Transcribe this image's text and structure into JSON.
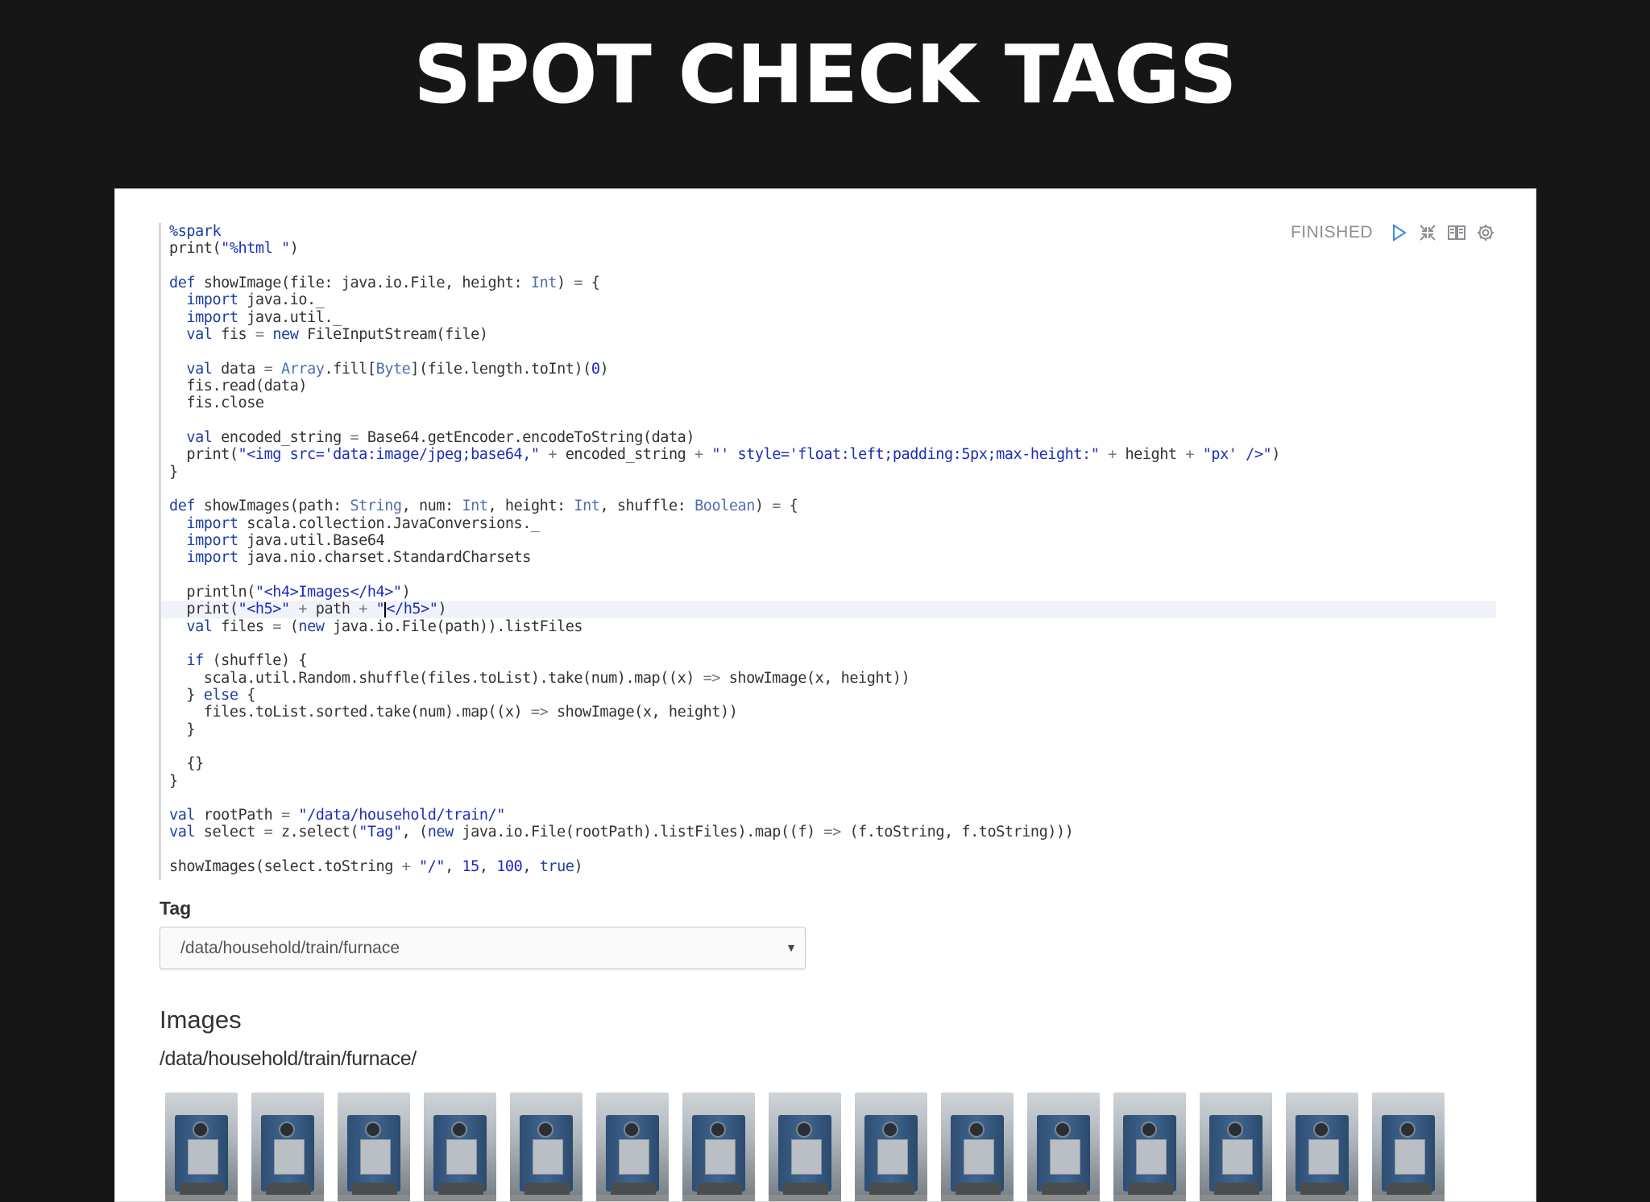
{
  "slide": {
    "title": "SPOT CHECK TAGS"
  },
  "paragraph": {
    "status": "FINISHED",
    "toolbar_icons": [
      "run-icon",
      "collapse-icon",
      "book-icon",
      "gear-icon"
    ],
    "code_lines": [
      [
        [
          "kw",
          "%spark"
        ]
      ],
      [
        [
          "plain",
          "print("
        ],
        [
          "str",
          "\"%html \""
        ],
        [
          "plain",
          ")"
        ]
      ],
      [],
      [
        [
          "kw",
          "def"
        ],
        [
          "plain",
          " showImage(file: java.io.File, height: "
        ],
        [
          "typ",
          "Int"
        ],
        [
          "plain",
          ") "
        ],
        [
          "op",
          "="
        ],
        [
          "plain",
          " {"
        ]
      ],
      [
        [
          "plain",
          "  "
        ],
        [
          "kw",
          "import"
        ],
        [
          "plain",
          " java.io._"
        ]
      ],
      [
        [
          "plain",
          "  "
        ],
        [
          "kw",
          "import"
        ],
        [
          "plain",
          " java.util._"
        ]
      ],
      [
        [
          "plain",
          "  "
        ],
        [
          "kw",
          "val"
        ],
        [
          "plain",
          " fis "
        ],
        [
          "op",
          "="
        ],
        [
          "plain",
          " "
        ],
        [
          "kw",
          "new"
        ],
        [
          "plain",
          " FileInputStream(file)"
        ]
      ],
      [],
      [
        [
          "plain",
          "  "
        ],
        [
          "kw",
          "val"
        ],
        [
          "plain",
          " data "
        ],
        [
          "op",
          "="
        ],
        [
          "plain",
          " "
        ],
        [
          "typ",
          "Array"
        ],
        [
          "plain",
          ".fill["
        ],
        [
          "typ",
          "Byte"
        ],
        [
          "plain",
          "](file.length.toInt)("
        ],
        [
          "num",
          "0"
        ],
        [
          "plain",
          ")"
        ]
      ],
      [
        [
          "plain",
          "  fis.read(data)"
        ]
      ],
      [
        [
          "plain",
          "  fis.close"
        ]
      ],
      [],
      [
        [
          "plain",
          "  "
        ],
        [
          "kw",
          "val"
        ],
        [
          "plain",
          " encoded_string "
        ],
        [
          "op",
          "="
        ],
        [
          "plain",
          " Base64.getEncoder.encodeToString(data)"
        ]
      ],
      [
        [
          "plain",
          "  print("
        ],
        [
          "str",
          "\"<img src='data:image/jpeg;base64,\""
        ],
        [
          "plain",
          " "
        ],
        [
          "op",
          "+"
        ],
        [
          "plain",
          " encoded_string "
        ],
        [
          "op",
          "+"
        ],
        [
          "plain",
          " "
        ],
        [
          "str",
          "\"' style='float:left;padding:5px;max-height:\""
        ],
        [
          "plain",
          " "
        ],
        [
          "op",
          "+"
        ],
        [
          "plain",
          " height "
        ],
        [
          "op",
          "+"
        ],
        [
          "plain",
          " "
        ],
        [
          "str",
          "\"px' />\""
        ],
        [
          "plain",
          ")"
        ]
      ],
      [
        [
          "plain",
          "}"
        ]
      ],
      [],
      [
        [
          "kw",
          "def"
        ],
        [
          "plain",
          " showImages(path: "
        ],
        [
          "typ",
          "String"
        ],
        [
          "plain",
          ", num: "
        ],
        [
          "typ",
          "Int"
        ],
        [
          "plain",
          ", height: "
        ],
        [
          "typ",
          "Int"
        ],
        [
          "plain",
          ", shuffle: "
        ],
        [
          "typ",
          "Boolean"
        ],
        [
          "plain",
          ") "
        ],
        [
          "op",
          "="
        ],
        [
          "plain",
          " {"
        ]
      ],
      [
        [
          "plain",
          "  "
        ],
        [
          "kw",
          "import"
        ],
        [
          "plain",
          " scala.collection.JavaConversions._"
        ]
      ],
      [
        [
          "plain",
          "  "
        ],
        [
          "kw",
          "import"
        ],
        [
          "plain",
          " java.util.Base64"
        ]
      ],
      [
        [
          "plain",
          "  "
        ],
        [
          "kw",
          "import"
        ],
        [
          "plain",
          " java.nio.charset.StandardCharsets"
        ]
      ],
      [],
      [
        [
          "plain",
          "  println("
        ],
        [
          "str",
          "\"<h4>Images</h4>\""
        ],
        [
          "plain",
          ")"
        ]
      ],
      [
        [
          "plain",
          "  print("
        ],
        [
          "str",
          "\"<h5>\""
        ],
        [
          "plain",
          " "
        ],
        [
          "op",
          "+"
        ],
        [
          "plain",
          " path "
        ],
        [
          "op",
          "+"
        ],
        [
          "plain",
          " "
        ],
        [
          "str",
          "\""
        ],
        [
          "cursor",
          ""
        ],
        [
          "str",
          "</h5>\""
        ],
        [
          "plain",
          ")"
        ]
      ],
      [
        [
          "plain",
          "  "
        ],
        [
          "kw",
          "val"
        ],
        [
          "plain",
          " files "
        ],
        [
          "op",
          "="
        ],
        [
          "plain",
          " ("
        ],
        [
          "kw",
          "new"
        ],
        [
          "plain",
          " java.io.File(path)).listFiles"
        ]
      ],
      [],
      [
        [
          "plain",
          "  "
        ],
        [
          "kw",
          "if"
        ],
        [
          "plain",
          " (shuffle) {"
        ]
      ],
      [
        [
          "plain",
          "    scala.util.Random.shuffle(files.toList).take(num).map((x) "
        ],
        [
          "op",
          "=>"
        ],
        [
          "plain",
          " showImage(x, height))"
        ]
      ],
      [
        [
          "plain",
          "  } "
        ],
        [
          "kw",
          "else"
        ],
        [
          "plain",
          " {"
        ]
      ],
      [
        [
          "plain",
          "    files.toList.sorted.take(num).map((x) "
        ],
        [
          "op",
          "=>"
        ],
        [
          "plain",
          " showImage(x, height))"
        ]
      ],
      [
        [
          "plain",
          "  }"
        ]
      ],
      [],
      [
        [
          "plain",
          "  {}"
        ]
      ],
      [
        [
          "plain",
          "}"
        ]
      ],
      [],
      [
        [
          "kw",
          "val"
        ],
        [
          "plain",
          " rootPath "
        ],
        [
          "op",
          "="
        ],
        [
          "plain",
          " "
        ],
        [
          "str",
          "\"/data/household/train/\""
        ]
      ],
      [
        [
          "kw",
          "val"
        ],
        [
          "plain",
          " select "
        ],
        [
          "op",
          "="
        ],
        [
          "plain",
          " z.select("
        ],
        [
          "str",
          "\"Tag\""
        ],
        [
          "plain",
          ", ("
        ],
        [
          "kw",
          "new"
        ],
        [
          "plain",
          " java.io.File(rootPath).listFiles).map((f) "
        ],
        [
          "op",
          "=>"
        ],
        [
          "plain",
          " (f.toString, f.toString)))"
        ]
      ],
      [],
      [
        [
          "plain",
          "showImages(select.toString "
        ],
        [
          "op",
          "+"
        ],
        [
          "plain",
          " "
        ],
        [
          "str",
          "\"/\""
        ],
        [
          "plain",
          ", "
        ],
        [
          "num",
          "15"
        ],
        [
          "plain",
          ", "
        ],
        [
          "num",
          "100"
        ],
        [
          "plain",
          ", "
        ],
        [
          "kw",
          "true"
        ],
        [
          "plain",
          ")"
        ]
      ]
    ],
    "active_line": 22,
    "form": {
      "label": "Tag",
      "selected": "/data/household/train/furnace"
    },
    "output": {
      "heading": "Images",
      "path": "/data/household/train/furnace/",
      "image_count": 15
    }
  }
}
